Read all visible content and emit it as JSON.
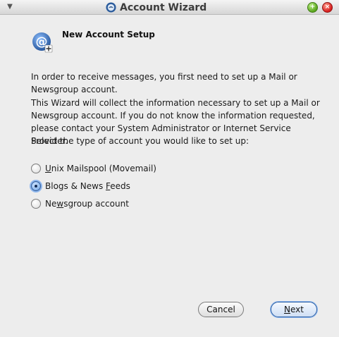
{
  "window": {
    "title": "Account Wizard"
  },
  "header": {
    "title": "New Account Setup"
  },
  "body": {
    "intro_line1": "In order to receive messages, you first need to set up a Mail or",
    "intro_line2": "Newsgroup account.",
    "info_line1": "This Wizard will collect the information necessary to set up a Mail or",
    "info_line2": "Newsgroup account. If you do not know the information requested,",
    "info_line3": "please contact your System Administrator or Internet Service Provider.",
    "prompt": "Select the type of account you would like to set up:"
  },
  "account_types": [
    {
      "pre": "",
      "mnemonic": "U",
      "post": "nix Mailspool (Movemail)",
      "checked": false
    },
    {
      "pre": "Blogs & News ",
      "mnemonic": "F",
      "post": "eeds",
      "checked": true
    },
    {
      "pre": "Ne",
      "mnemonic": "w",
      "post": "sgroup account",
      "checked": false
    }
  ],
  "buttons": {
    "cancel_label": "Cancel",
    "next_mnemonic": "N",
    "next_rest": "ext"
  },
  "colors": {
    "background": "#ededed",
    "accent": "#2b5fa3"
  }
}
